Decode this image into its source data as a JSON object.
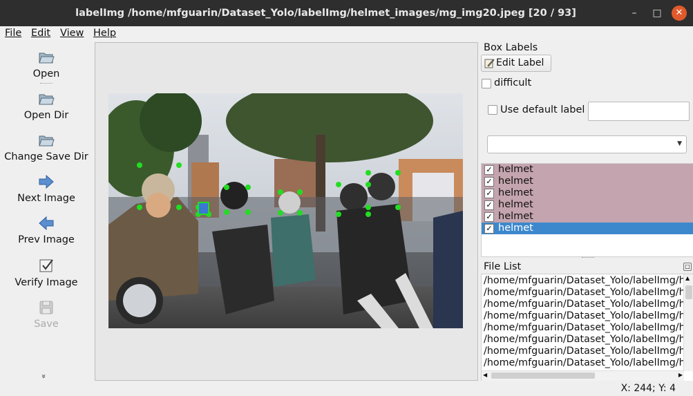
{
  "window": {
    "title": "labelImg /home/mfguarin/Dataset_Yolo/labelImg/helmet_images/mg_img20.jpeg [20 / 93]"
  },
  "menubar": {
    "items": [
      "File",
      "Edit",
      "View",
      "Help"
    ]
  },
  "toolbar": {
    "items": [
      {
        "label": "Open",
        "icon": "folder-icon",
        "enabled": true
      },
      {
        "label": "Open Dir",
        "icon": "folder-icon",
        "enabled": true
      },
      {
        "label": "Change Save Dir",
        "icon": "folder-icon",
        "enabled": true
      },
      {
        "label": "Next Image",
        "icon": "arrow-right-icon",
        "enabled": true
      },
      {
        "label": "Prev Image",
        "icon": "arrow-left-icon",
        "enabled": true
      },
      {
        "label": "Verify Image",
        "icon": "checkbox-icon",
        "enabled": true
      },
      {
        "label": "Save",
        "icon": "floppy-icon",
        "enabled": false
      }
    ],
    "more": "»"
  },
  "box_labels": {
    "title": "Box Labels",
    "edit_label_button": "Edit Label",
    "difficult_label": "difficult",
    "difficult_checked": false,
    "use_default_label": "Use default label",
    "use_default_checked": false,
    "default_label_value": "",
    "combo_value": "",
    "labels": [
      {
        "text": "helmet",
        "checked": true,
        "selected": false
      },
      {
        "text": "helmet",
        "checked": true,
        "selected": false
      },
      {
        "text": "helmet",
        "checked": true,
        "selected": false
      },
      {
        "text": "helmet",
        "checked": true,
        "selected": false
      },
      {
        "text": "helmet",
        "checked": true,
        "selected": false
      },
      {
        "text": "helmet",
        "checked": true,
        "selected": true
      }
    ]
  },
  "file_list": {
    "title": "File List",
    "files": [
      "/home/mfguarin/Dataset_Yolo/labelImg/h",
      "/home/mfguarin/Dataset_Yolo/labelImg/h",
      "/home/mfguarin/Dataset_Yolo/labelImg/h",
      "/home/mfguarin/Dataset_Yolo/labelImg/h",
      "/home/mfguarin/Dataset_Yolo/labelImg/h",
      "/home/mfguarin/Dataset_Yolo/labelImg/h",
      "/home/mfguarin/Dataset_Yolo/labelImg/h",
      "/home/mfguarin/Dataset_Yolo/labelImg/h"
    ]
  },
  "status": {
    "coordinates": "X: 244; Y: 4"
  },
  "colors": {
    "label_row": "#c4a4ae",
    "selected_row": "#3d88cc",
    "vertex": "#22dd22",
    "selected_vertex": "#3a78d6"
  }
}
